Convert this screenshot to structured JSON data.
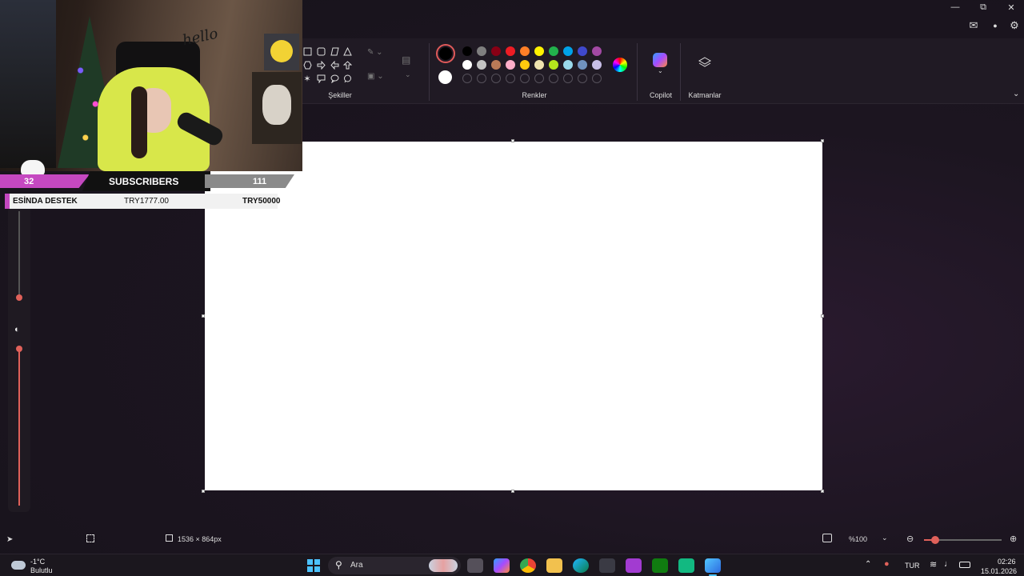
{
  "ribbon": {
    "shapes_label": "Şekiller",
    "colors_label": "Renkler",
    "copilot_label": "Copilot",
    "layers_label": "Katmanlar",
    "swatches_row1": [
      "#000000",
      "#7f7f7f",
      "#880015",
      "#ed1c24",
      "#ff7f27",
      "#fff200",
      "#22b14c",
      "#00a2e8",
      "#3f48cc",
      "#a349a4"
    ],
    "swatches_row2": [
      "#ffffff",
      "#c3c3c3",
      "#b97a57",
      "#ffaec9",
      "#ffc90e",
      "#efe4b0",
      "#b5e61d",
      "#99d9ea",
      "#7092be",
      "#c8bfe7"
    ]
  },
  "stream": {
    "sub_count_left": "32",
    "subscribers_label": "SUBSCRIBERS",
    "sub_count_right": "111",
    "donation_label": "ESİNDA DESTEK",
    "donation_current": "TRY1777.00",
    "donation_goal": "TRY50000",
    "wall_text": "hello"
  },
  "status": {
    "canvas_size": "1536 × 864px",
    "zoom": "%100"
  },
  "taskbar": {
    "weather_temp": "-1°C",
    "weather_desc": "Bulutlu",
    "search_placeholder": "Ara",
    "language": "TUR",
    "time": "02:26",
    "date": "15.01.2026"
  }
}
